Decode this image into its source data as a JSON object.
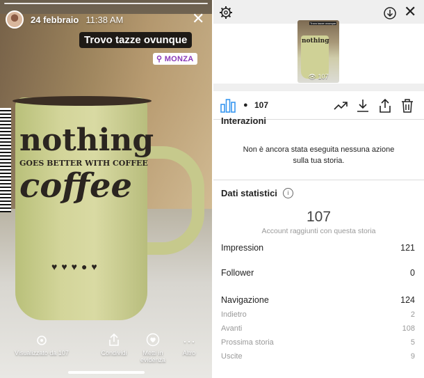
{
  "story": {
    "date": "24 febbraio",
    "time": "11:38 AM",
    "caption": "Trovo tazze ovunque",
    "location": "MONZA",
    "mug_lines": [
      "nothing",
      "GOES BETTER WITH COFFEE",
      "coffee"
    ],
    "bottom_actions": [
      {
        "icon": "eye-icon",
        "label": "Visualizzato da 107"
      },
      {
        "icon": "share-icon",
        "label": "Condividi"
      },
      {
        "icon": "heart-icon",
        "label": "Metti in evidenza"
      },
      {
        "icon": "more-icon",
        "label": "Altro"
      }
    ]
  },
  "insights": {
    "thumbnail_count": "107",
    "toolbar_count": "107",
    "interactions_title": "Interazioni",
    "no_action_text": "Non è ancora stata eseguita nessuna azione sulla tua storia.",
    "stats_title": "Dati statistici",
    "reach_value": "107",
    "reach_label": "Account raggiunti con questa storia",
    "rows": [
      {
        "label": "Impression",
        "value": "121"
      },
      {
        "label": "Follower",
        "value": "0"
      },
      {
        "label": "Navigazione",
        "value": "124"
      }
    ],
    "nav_rows": [
      {
        "label": "Indietro",
        "value": "2"
      },
      {
        "label": "Avanti",
        "value": "108"
      },
      {
        "label": "Prossima storia",
        "value": "5"
      },
      {
        "label": "Uscite",
        "value": "9"
      }
    ]
  }
}
